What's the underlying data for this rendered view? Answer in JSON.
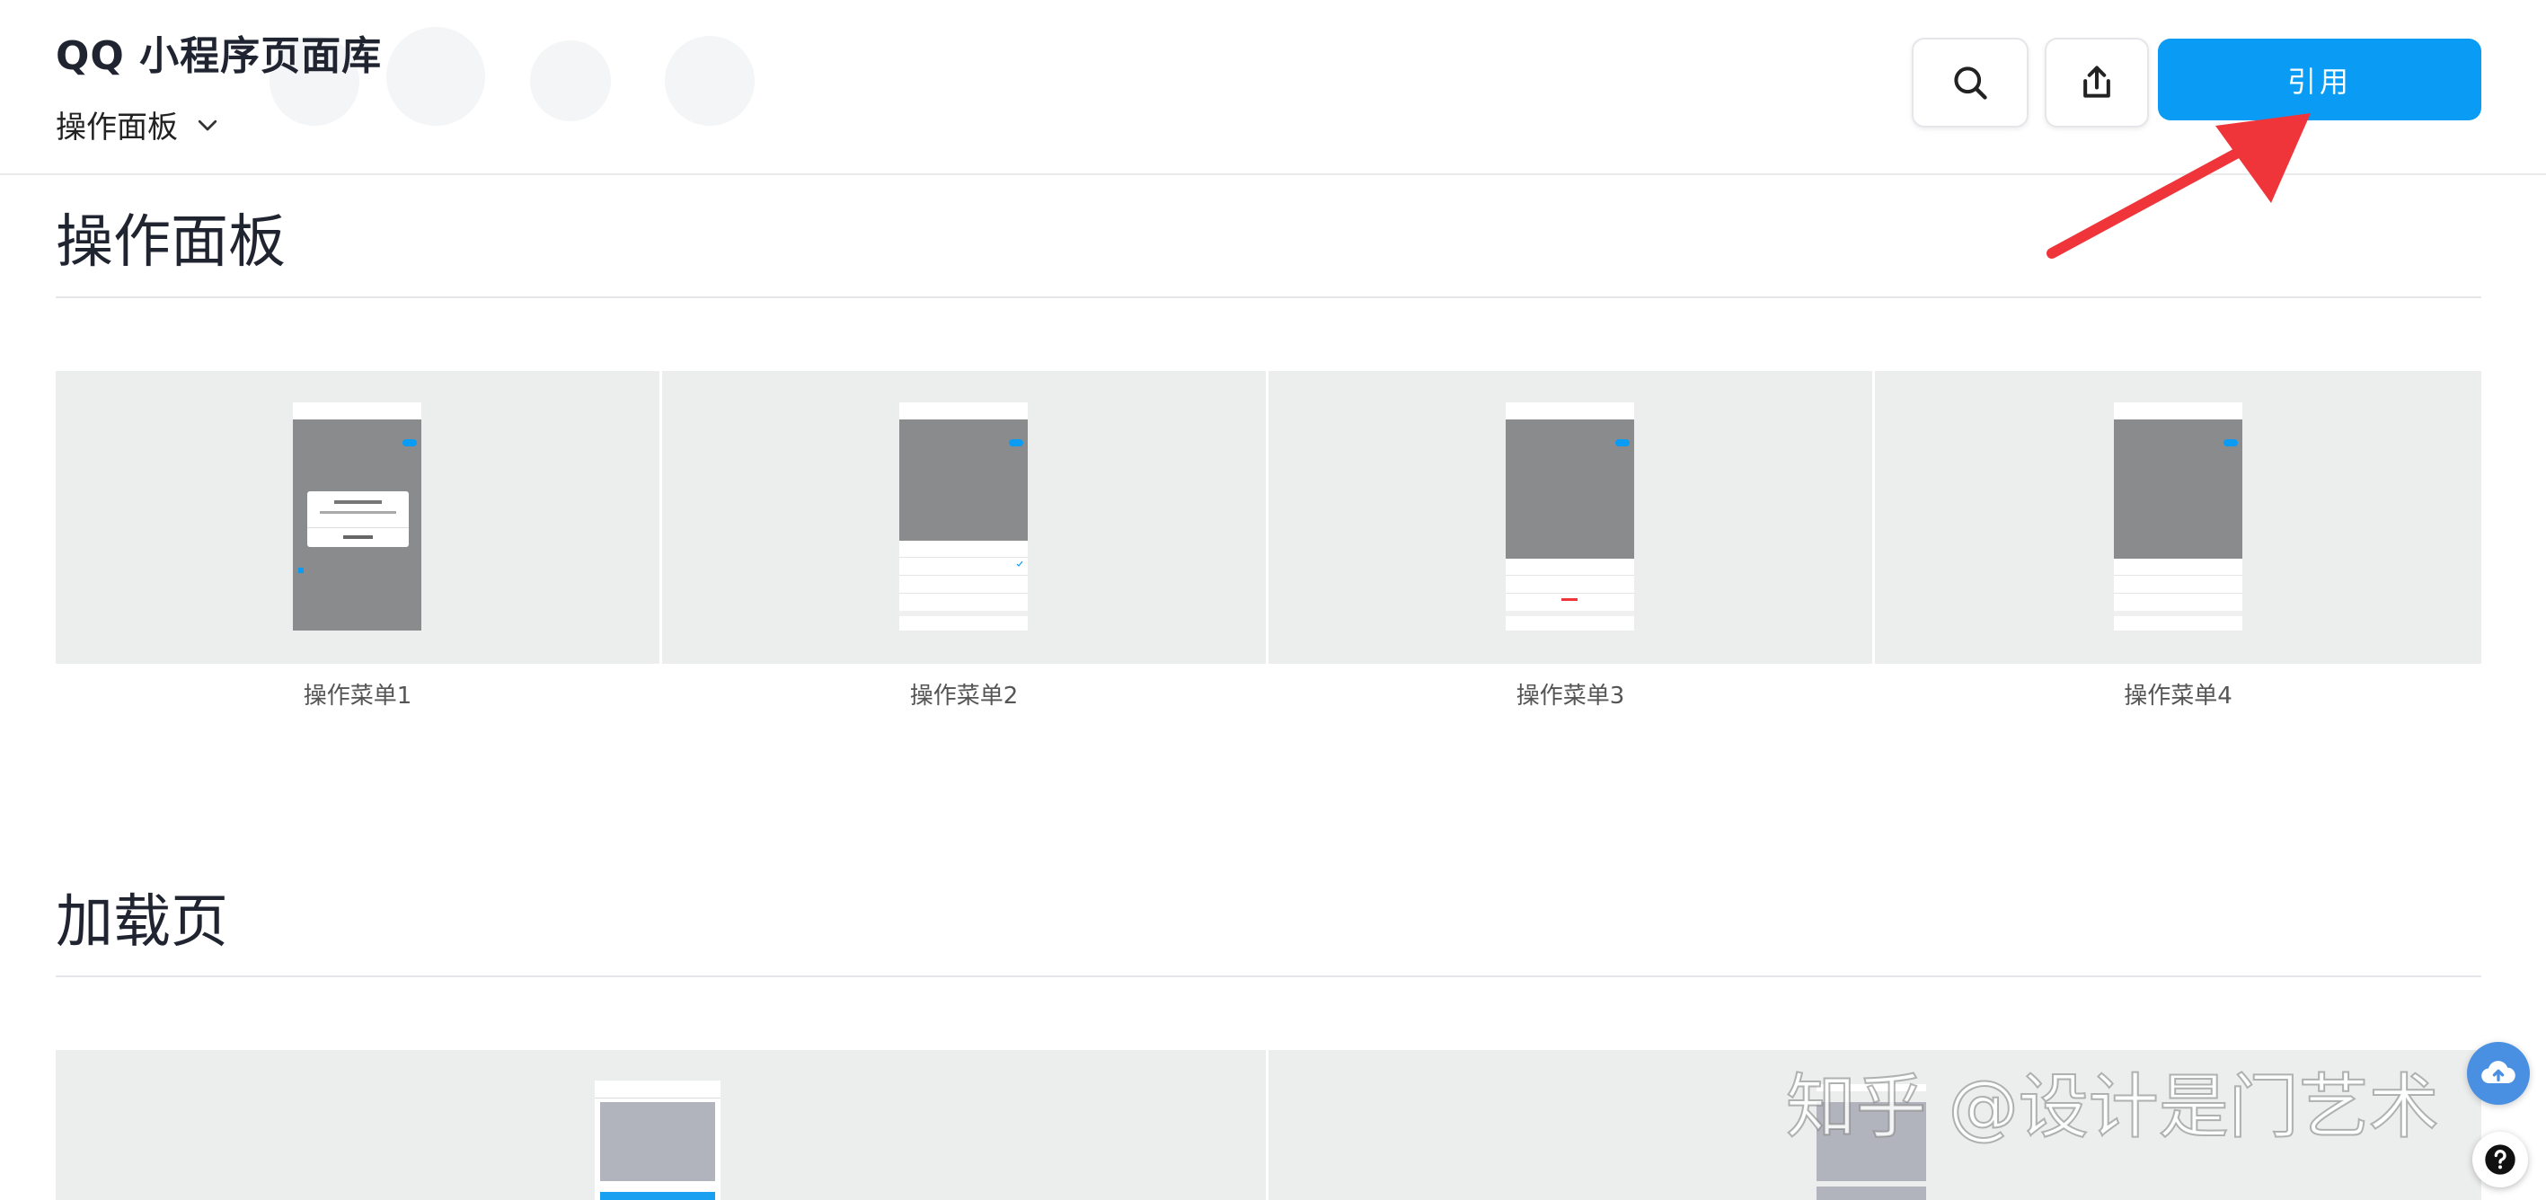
{
  "header": {
    "app_title": "QQ 小程序页面库",
    "page_select": "操作面板",
    "cite_label": "引用"
  },
  "icons": {
    "search": "search-icon",
    "share": "share-icon",
    "chevron": "chevron-down-icon",
    "cloud": "cloud-upload-icon",
    "help": "help-icon"
  },
  "sections": [
    {
      "title": "操作面板",
      "cards": [
        {
          "caption": "操作菜单1"
        },
        {
          "caption": "操作菜单2"
        },
        {
          "caption": "操作菜单3"
        },
        {
          "caption": "操作菜单4"
        }
      ]
    },
    {
      "title": "加载页"
    }
  ],
  "watermark": "知乎 @设计是门艺术",
  "colors": {
    "accent": "#0a9cf5",
    "arrow": "#f0353a",
    "card_bg": "#eceded"
  }
}
